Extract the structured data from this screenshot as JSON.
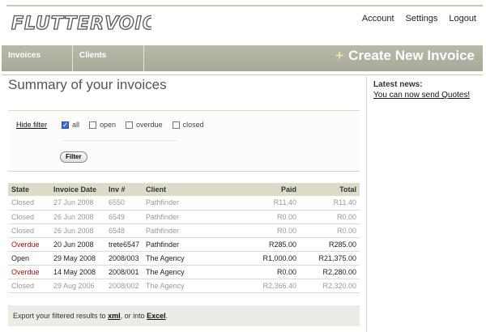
{
  "app": {
    "logo_text": "FLUTTERVOICE"
  },
  "top_nav": {
    "account": "Account",
    "settings": "Settings",
    "logout": "Logout"
  },
  "nav": {
    "invoices": "Invoices",
    "clients": "Clients",
    "create_label": "Create New Invoice",
    "create_plus": "+"
  },
  "page": {
    "title": "Summary of your invoices"
  },
  "filter": {
    "hide_label": "Hide filter",
    "options": [
      {
        "label": "all",
        "checked": true
      },
      {
        "label": "open",
        "checked": false
      },
      {
        "label": "overdue",
        "checked": false
      },
      {
        "label": "closed",
        "checked": false
      }
    ],
    "button_label": "Filter"
  },
  "table": {
    "headers": [
      "State",
      "Invoice Date",
      "Inv #",
      "Client",
      "Paid",
      "Total"
    ],
    "rows": [
      {
        "state": "Closed",
        "date": "27 Jun 2008",
        "inv": "6550",
        "client": "Pathfinder",
        "paid": "R11.40",
        "total": "R11.40"
      },
      {
        "state": "Closed",
        "date": "26 Jun 2008",
        "inv": "6549",
        "client": "Pathfinder",
        "paid": "R0.00",
        "total": "R0.00"
      },
      {
        "state": "Closed",
        "date": "26 Jun 2008",
        "inv": "6548",
        "client": "Pathfinder",
        "paid": "R0.00",
        "total": "R0.00"
      },
      {
        "state": "Overdue",
        "date": "20 Jun 2008",
        "inv": "trete6547",
        "client": "Pathfinder",
        "paid": "R285.00",
        "total": "R285.00"
      },
      {
        "state": "Open",
        "date": "29 May 2008",
        "inv": "2008/003",
        "client": "The Agency",
        "paid": "R1,000.00",
        "total": "R21,375.00"
      },
      {
        "state": "Overdue",
        "date": "14 May 2008",
        "inv": "2008/001",
        "client": "The Agency",
        "paid": "R0.00",
        "total": "R2,280.00"
      },
      {
        "state": "Closed",
        "date": "29 Aug 2006",
        "inv": "2008/002",
        "client": "The Agency",
        "paid": "R2,366.40",
        "total": "R2,320.00"
      }
    ]
  },
  "export": {
    "prefix": "Export your filtered results to",
    "xml": "xml",
    "middle": ", or into",
    "excel": "Excel",
    "suffix": "."
  },
  "sidebar": {
    "news_label": "Latest news:",
    "news_link": "You can now send Quotes!"
  },
  "colors": {
    "overdue": "#b10d0d",
    "nav_bg": "#b1b1a2",
    "table_header_bg": "#dddccb"
  }
}
